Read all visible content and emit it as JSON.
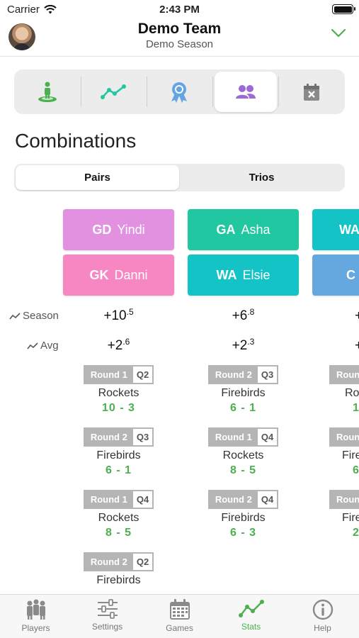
{
  "status_bar": {
    "carrier": "Carrier",
    "time": "2:43 PM"
  },
  "header": {
    "team": "Demo Team",
    "season": "Demo Season"
  },
  "icon_tabs": [
    {
      "icon": "player-position-icon",
      "active": false
    },
    {
      "icon": "trend-chart-icon",
      "active": false
    },
    {
      "icon": "award-ribbon-icon",
      "active": false
    },
    {
      "icon": "people-pair-icon",
      "active": true
    },
    {
      "icon": "calendar-x-icon",
      "active": false
    }
  ],
  "section_title": "Combinations",
  "mode_tabs": {
    "pairs": "Pairs",
    "trios": "Trios",
    "selected": "pairs"
  },
  "row_labels": {
    "season": "Season",
    "avg": "Avg"
  },
  "colors": {
    "accent_green": "#4caf50",
    "pink_light": "#e191e0",
    "pink": "#f687c2",
    "teal_green": "#21c7a0",
    "teal": "#13c3c6",
    "blue": "#64a8df",
    "icon_blue": "#64a4e2"
  },
  "columns": [
    {
      "players": [
        {
          "pos": "GD",
          "name": "Yindi",
          "color": "#e191e0"
        },
        {
          "pos": "GK",
          "name": "Danni",
          "color": "#f687c2"
        }
      ],
      "season": {
        "int": "+10",
        "dec": ".5"
      },
      "avg": {
        "int": "+2",
        "dec": ".6"
      },
      "games": [
        {
          "round": "Round 1",
          "quarter": "Q2",
          "opponent": "Rockets",
          "score": "10 - 3"
        },
        {
          "round": "Round 2",
          "quarter": "Q3",
          "opponent": "Firebirds",
          "score": "6 - 1"
        },
        {
          "round": "Round 1",
          "quarter": "Q4",
          "opponent": "Rockets",
          "score": "8 - 5"
        },
        {
          "round": "Round 2",
          "quarter": "Q2",
          "opponent": "Firebirds",
          "score": ""
        }
      ]
    },
    {
      "players": [
        {
          "pos": "GA",
          "name": "Asha",
          "color": "#21c7a0"
        },
        {
          "pos": "WA",
          "name": "Elsie",
          "color": "#13c3c6"
        }
      ],
      "season": {
        "int": "+6",
        "dec": ".8"
      },
      "avg": {
        "int": "+2",
        "dec": ".3"
      },
      "games": [
        {
          "round": "Round 2",
          "quarter": "Q3",
          "opponent": "Firebirds",
          "score": "6 - 1"
        },
        {
          "round": "Round 1",
          "quarter": "Q4",
          "opponent": "Rockets",
          "score": "8 - 5"
        },
        {
          "round": "Round 2",
          "quarter": "Q4",
          "opponent": "Firebirds",
          "score": "6 - 3"
        }
      ]
    },
    {
      "players": [
        {
          "pos": "WA",
          "name": "",
          "color": "#13c3c6"
        },
        {
          "pos": "C",
          "name": "",
          "color": "#64a8df"
        }
      ],
      "season": {
        "int": "+",
        "dec": ""
      },
      "avg": {
        "int": "+",
        "dec": ""
      },
      "games": [
        {
          "round": "Round",
          "quarter": "",
          "opponent": "Ro",
          "score": "1"
        },
        {
          "round": "Round",
          "quarter": "",
          "opponent": "Fire",
          "score": "6"
        },
        {
          "round": "Round",
          "quarter": "",
          "opponent": "Fire",
          "score": "2"
        }
      ]
    }
  ],
  "bottom_nav": [
    {
      "label": "Players",
      "icon": "players-icon",
      "active": false
    },
    {
      "label": "Settings",
      "icon": "sliders-icon",
      "active": false
    },
    {
      "label": "Games",
      "icon": "calendar-icon",
      "active": false
    },
    {
      "label": "Stats",
      "icon": "trend-chart-icon",
      "active": true
    },
    {
      "label": "Help",
      "icon": "info-icon",
      "active": false
    }
  ]
}
